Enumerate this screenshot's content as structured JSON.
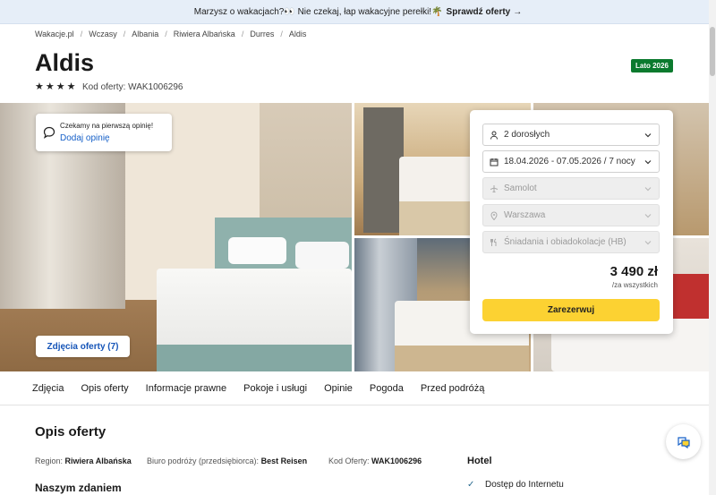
{
  "promo": {
    "text": "Marzysz o wakacjach?👀 Nie czekaj, łap wakacyjne perełki!🌴",
    "link": "Sprawdź oferty",
    "arrow": "→"
  },
  "breadcrumb": [
    "Wakacje.pl",
    "Wczasy",
    "Albania",
    "Riwiera Albańska",
    "Durres",
    "Aldis"
  ],
  "hotel": {
    "name": "Aldis",
    "stars": 4,
    "code_label": "Kod oferty: WAK1006296",
    "season_badge": "Lato 2026"
  },
  "review": {
    "text": "Czekamy na pierwszą opinię!",
    "link": "Dodaj opinię"
  },
  "gallery": {
    "photos_button": "Zdjęcia oferty (7)"
  },
  "booking": {
    "guests": "2 dorosłych",
    "dates": "18.04.2026 - 07.05.2026 / 7 nocy",
    "transport": "Samolot",
    "departure": "Warszawa",
    "board": "Śniadania i obiadokolacje (HB)",
    "price": "3 490 zł",
    "price_note": "/za wszystkich",
    "reserve_label": "Zarezerwuj"
  },
  "tabs": [
    "Zdjęcia",
    "Opis oferty",
    "Informacje prawne",
    "Pokoje i usługi",
    "Opinie",
    "Pogoda",
    "Przed podróżą"
  ],
  "description": {
    "title": "Opis oferty",
    "region_label": "Region:",
    "region_value": "Riwiera Albańska",
    "agency_label": "Biuro podróży (przedsiębiorca):",
    "agency_value": "Best Reisen",
    "code_label": "Kod Oferty:",
    "code_value": "WAK1006296",
    "subtitle": "Naszym zdaniem"
  },
  "hotel_features": {
    "title": "Hotel",
    "items": [
      "Dostęp do Internetu"
    ]
  },
  "colors": {
    "accent": "#fcd232",
    "link": "#1660c8",
    "badge": "#0b7a2e"
  }
}
